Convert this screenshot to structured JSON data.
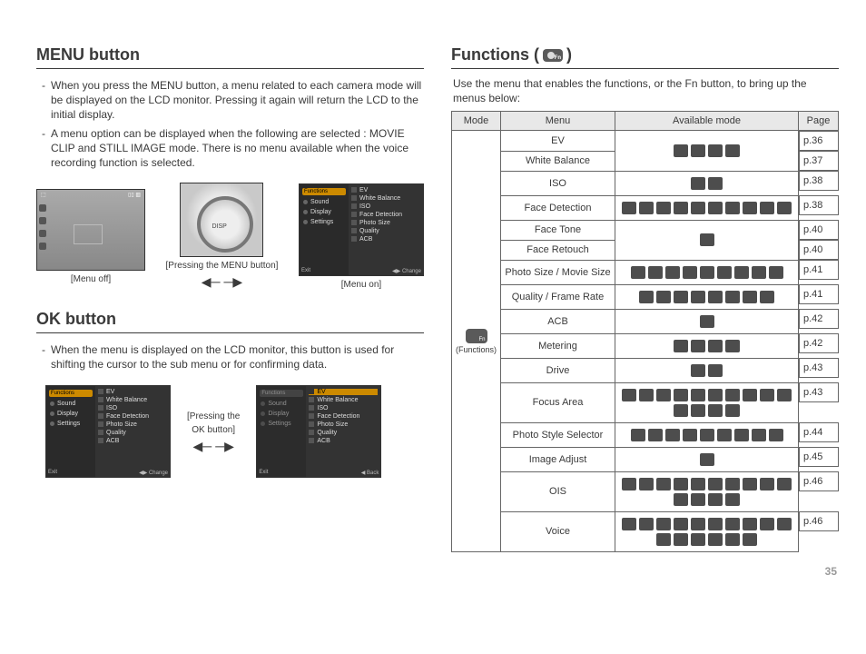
{
  "left": {
    "heading_menu": "MENU button",
    "bullet1": "When you press the MENU button, a menu related to each camera mode will be displayed on the LCD monitor. Pressing it again will return the LCD to the initial display.",
    "bullet2": "A menu option can be displayed when the following are selected : MOVIE CLIP and STILL IMAGE mode. There is no menu available when the voice recording function is selected.",
    "menu_off": "[Menu off]",
    "menu_on": "[Menu on]",
    "pressing_menu": "[Pressing the MENU button]",
    "heading_ok": "OK button",
    "ok_bullet": "When the menu is displayed on the LCD monitor, this button is used for shifting the cursor to the sub menu or for confirming data.",
    "pressing_ok_l1": "[Pressing the",
    "pressing_ok_l2": "OK button]",
    "panel": {
      "header": "Functions",
      "sound": "Sound",
      "display": "Display",
      "settings": "Settings",
      "ev": "EV",
      "wb": "White Balance",
      "iso": "ISO",
      "face": "Face Detection",
      "psize": "Photo Size",
      "quality": "Quality",
      "acb": "ACB",
      "exit": "Exit",
      "change": "Change",
      "back": "Back"
    }
  },
  "right": {
    "heading_pre": "Functions (",
    "heading_post": " )",
    "lead": "Use the menu that enables the functions, or the Fn button, to bring up the menus below:",
    "th_mode": "Mode",
    "th_menu": "Menu",
    "th_avail": "Available mode",
    "th_page": "Page",
    "mode_label": "(Functions)",
    "rows": {
      "r0": {
        "m": "EV",
        "p": "p.36",
        "n": 4
      },
      "r1": {
        "m": "White Balance",
        "p": "p.37",
        "n": 0
      },
      "r2": {
        "m": "ISO",
        "p": "p.38",
        "n": 2
      },
      "r3": {
        "m": "Face Detection",
        "p": "p.38",
        "n": 10
      },
      "r4": {
        "m": "Face Tone",
        "p": "p.40",
        "n": 0
      },
      "r5": {
        "m": "Face Retouch",
        "p": "p.40",
        "n": 1
      },
      "r6": {
        "m": "Photo Size / Movie Size",
        "p": "p.41",
        "n": 9
      },
      "r7": {
        "m": "Quality / Frame Rate",
        "p": "p.41",
        "n": 8
      },
      "r8": {
        "m": "ACB",
        "p": "p.42",
        "n": 1
      },
      "r9": {
        "m": "Metering",
        "p": "p.42",
        "n": 4
      },
      "r10": {
        "m": "Drive",
        "p": "p.43",
        "n": 2
      },
      "r11": {
        "m": "Focus Area",
        "p": "p.43",
        "n": 14
      },
      "r12": {
        "m": "Photo Style Selector",
        "p": "p.44",
        "n": 9
      },
      "r13": {
        "m": "Image Adjust",
        "p": "p.45",
        "n": 1
      },
      "r14": {
        "m": "OIS",
        "p": "p.46",
        "n": 14
      },
      "r15": {
        "m": "Voice",
        "p": "p.46",
        "n": 16
      }
    }
  },
  "page_number": "35"
}
